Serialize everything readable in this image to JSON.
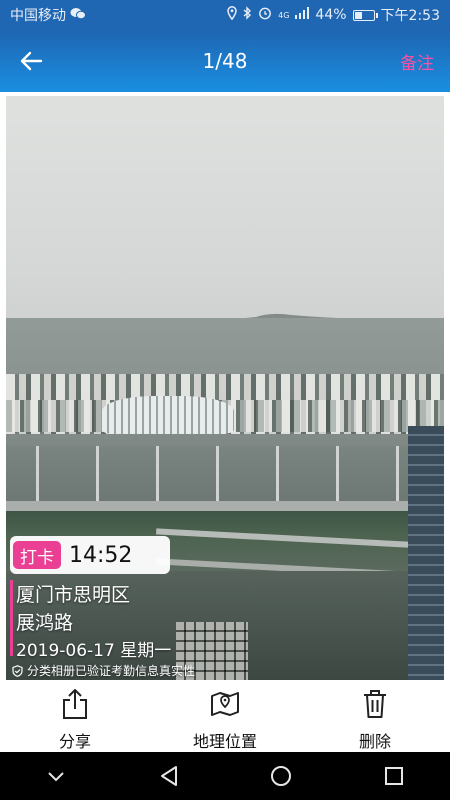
{
  "status_bar": {
    "carrier": "中国移动",
    "network": "4G",
    "battery": "44%",
    "battery_level": 0.44,
    "time": "下午2:53"
  },
  "app_bar": {
    "counter": "1/48",
    "note_label": "备注",
    "accent_color": "#ff4fa0"
  },
  "watermark": {
    "tag": "打卡",
    "time": "14:52",
    "address_line1": "厦门市思明区",
    "address_line2": "展鸿路",
    "date": "2019-06-17 星期一",
    "verification": "分类相册已验证考勤信息真实性",
    "tag_color": "#ea3f93"
  },
  "actions": [
    {
      "label": "分享",
      "icon": "share-icon"
    },
    {
      "label": "地理位置",
      "icon": "map-pin-icon"
    },
    {
      "label": "删除",
      "icon": "trash-icon"
    }
  ],
  "nav_bar": {
    "buttons": [
      "chevron-down-icon",
      "back-triangle-icon",
      "home-circle-icon",
      "recents-square-icon"
    ]
  }
}
